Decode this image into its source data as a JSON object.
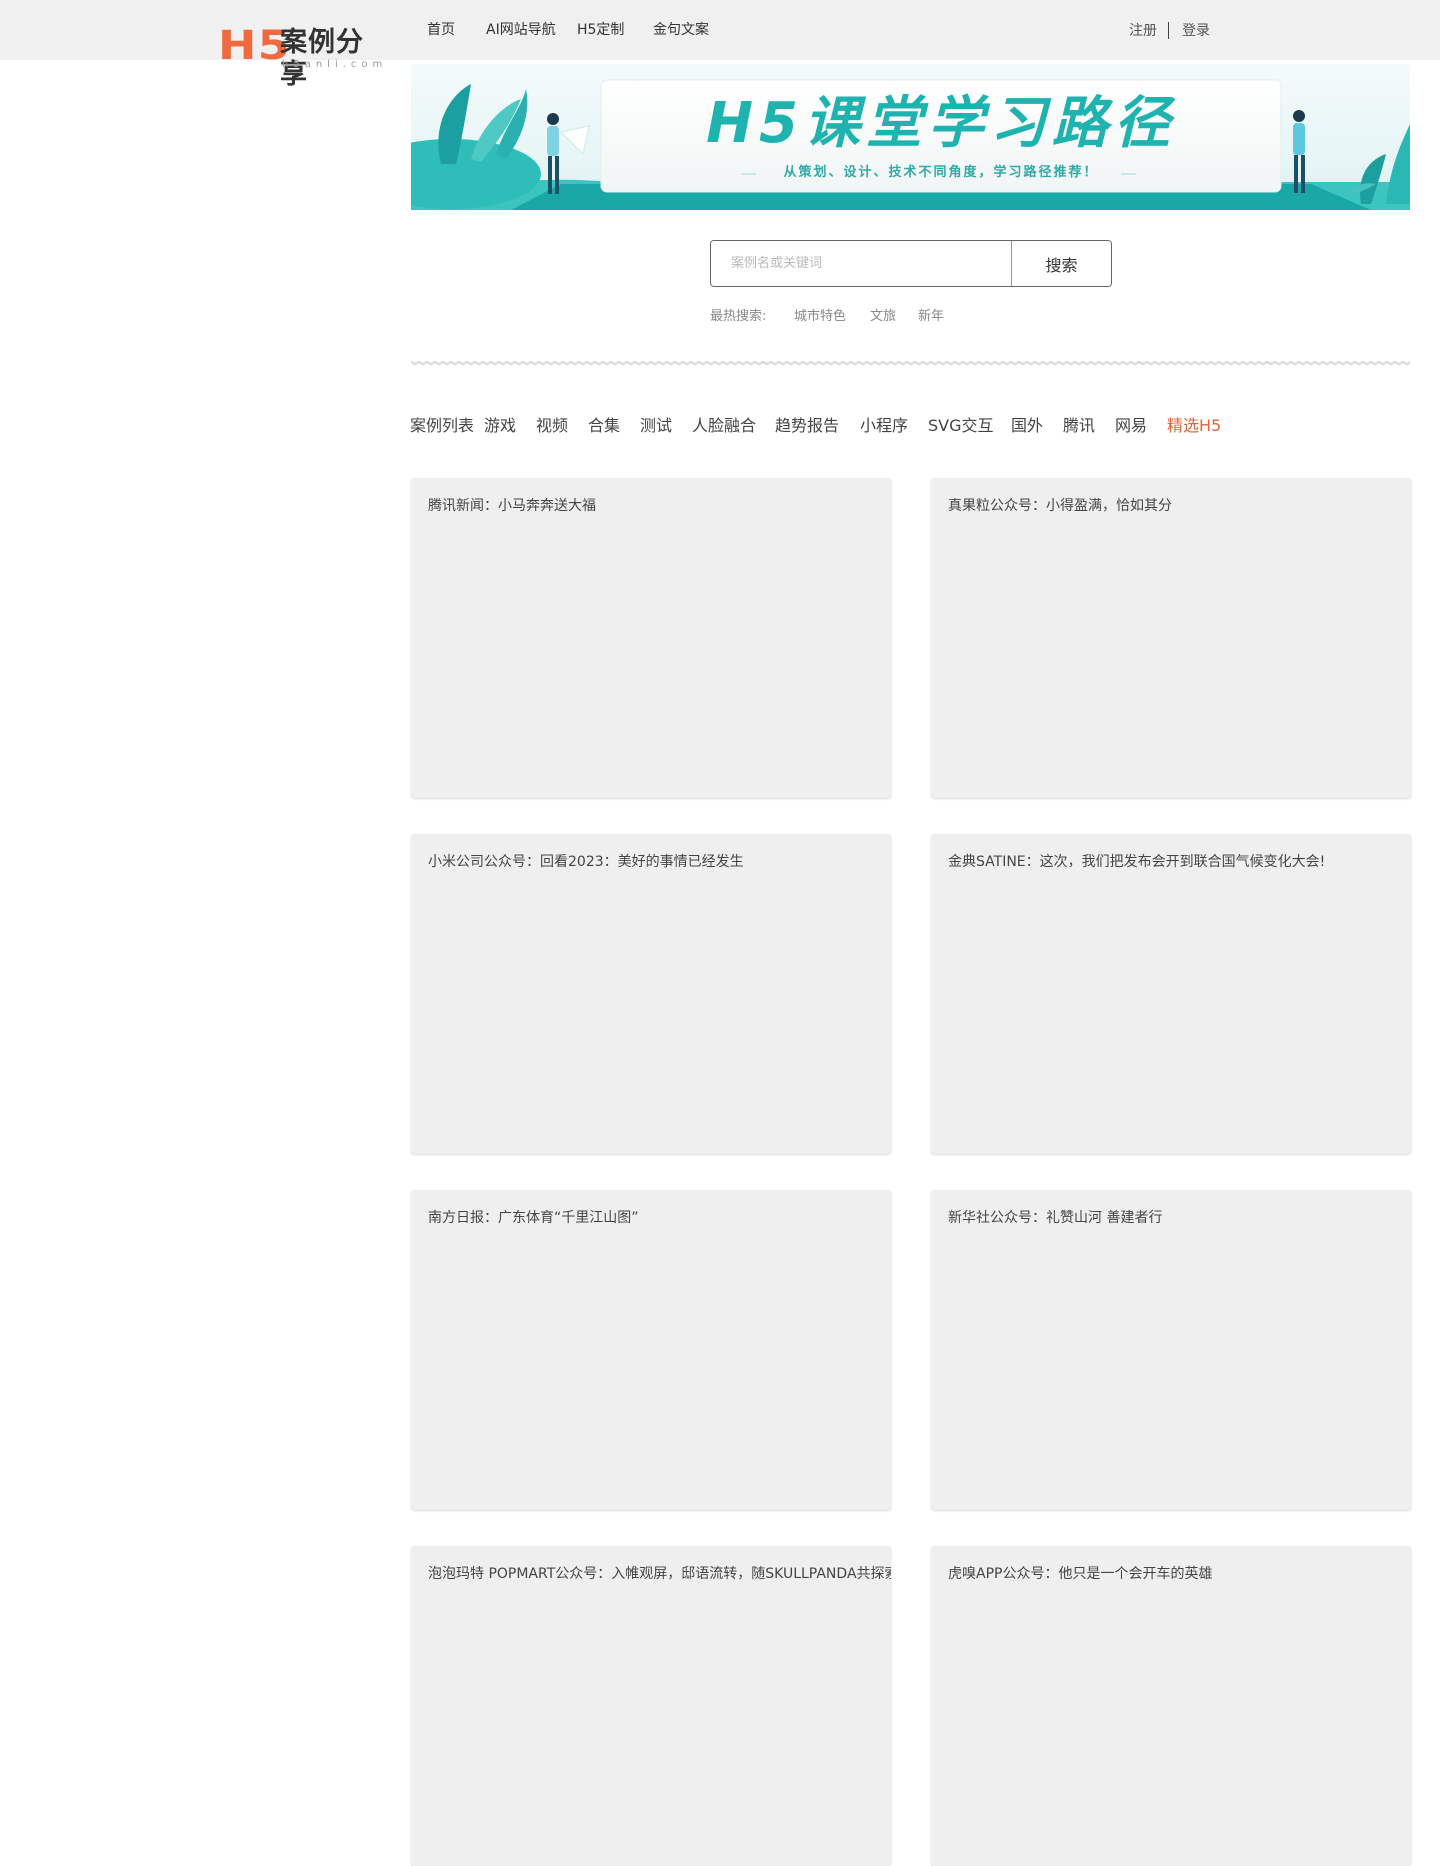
{
  "logo": {
    "mark": "H5",
    "name": "案例分享",
    "domain": "h5anli.com"
  },
  "nav": {
    "items": [
      {
        "label": "首页"
      },
      {
        "label": "AI网站导航"
      },
      {
        "label": "H5定制"
      },
      {
        "label": "金句文案"
      }
    ],
    "register": "注册",
    "login": "登录"
  },
  "banner": {
    "title": "H5课堂学习路径",
    "subtitle": "从策划、设计、技术不同角度，学习路径推荐！",
    "colors": {
      "teal": "#1fb3b0",
      "light": "#eef7f8"
    }
  },
  "search": {
    "placeholder": "案例名或关键词",
    "value": "",
    "button_label": "搜索",
    "hot_label": "最热搜索:",
    "hot_terms": [
      "城市特色",
      "文旅",
      "新年"
    ]
  },
  "categories": {
    "list_label": "案例列表",
    "items": [
      "游戏",
      "视频",
      "合集",
      "测试",
      "人脸融合",
      "趋势报告",
      "小程序",
      "SVG交互",
      "国外",
      "腾讯",
      "网易",
      "精选H5"
    ],
    "active": "精选H5",
    "active_color": "#e0653f"
  },
  "cards": [
    {
      "title": "腾讯新闻：小马奔奔送大福"
    },
    {
      "title": "真果粒公众号：小得盈满，恰如其分"
    },
    {
      "title": "小米公司公众号：回看2023：美好的事情已经发生"
    },
    {
      "title": "金典SATINE：这次，我们把发布会开到联合国气候变化大会!"
    },
    {
      "title": "南方日报：广东体育“千里江山图”"
    },
    {
      "title": "新华社公众号：礼赞山河 善建者行"
    },
    {
      "title": "泡泡玛特 POPMART公众号：入帷观屏，邸语流转，随SKULLPANDA共探索"
    },
    {
      "title": "虎嗅APP公众号：他只是一个会开车的英雄"
    }
  ]
}
